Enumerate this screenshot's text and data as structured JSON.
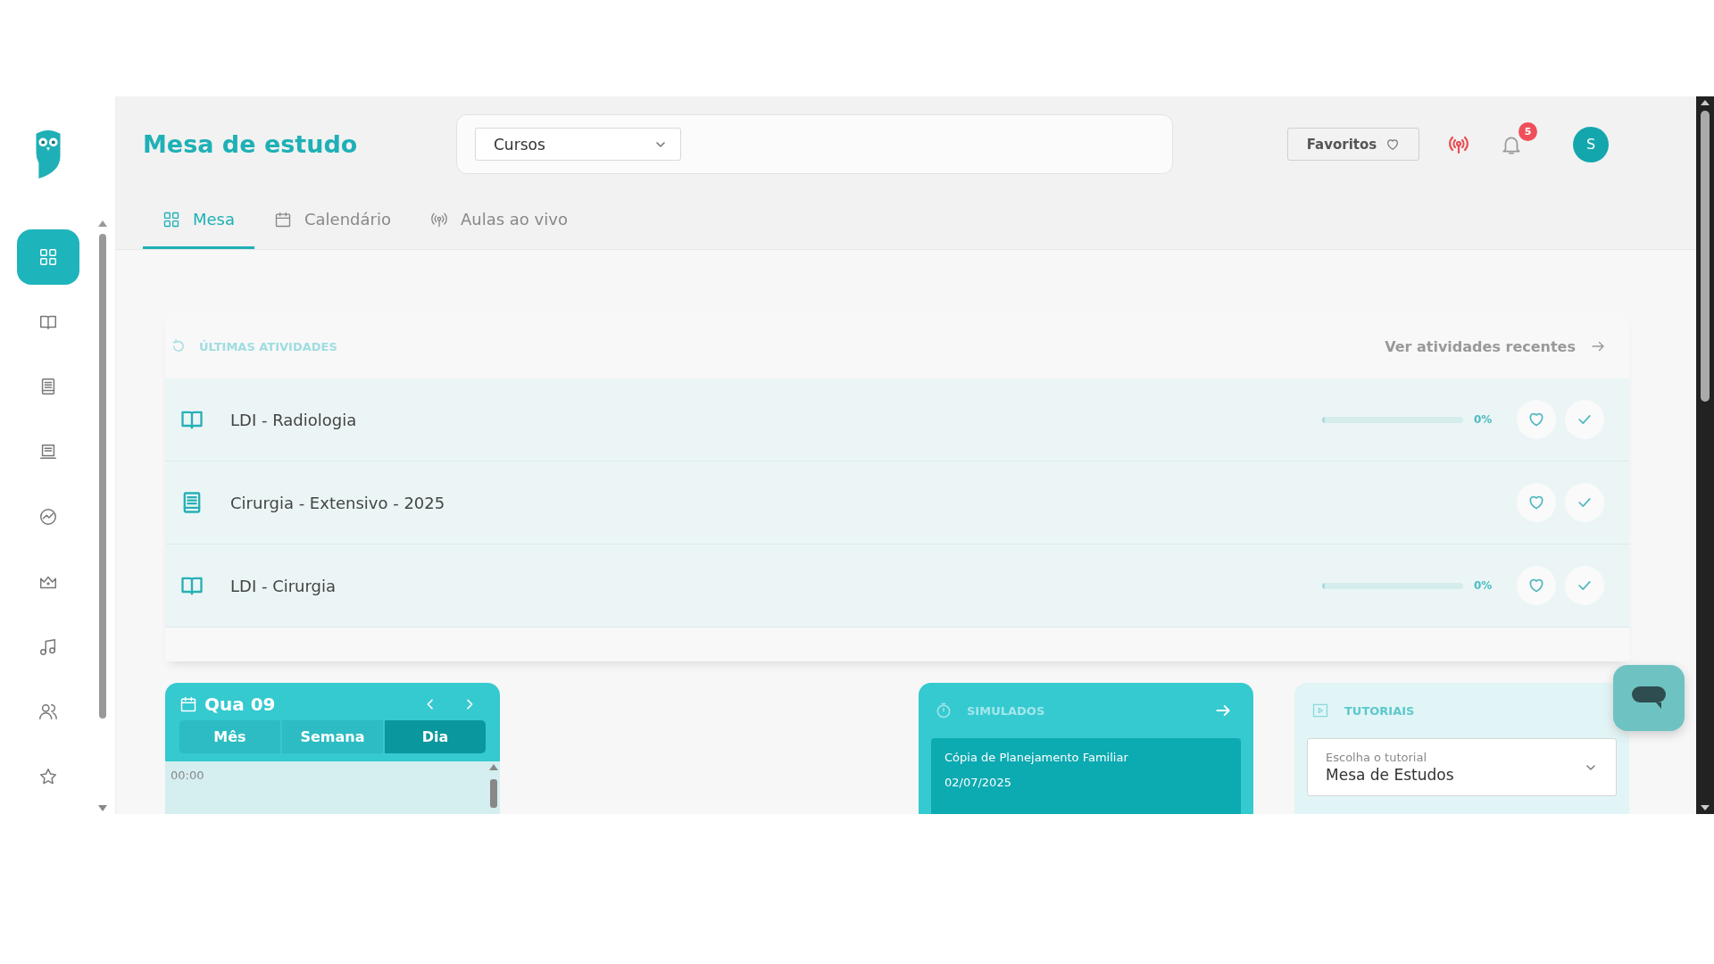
{
  "sidebar": {
    "items": [
      {
        "kind": "grid",
        "selected": true
      },
      {
        "kind": "book",
        "selected": false
      },
      {
        "kind": "notebook",
        "selected": false
      },
      {
        "kind": "laptop",
        "selected": false
      },
      {
        "kind": "chart",
        "selected": false
      },
      {
        "kind": "crown",
        "selected": false
      },
      {
        "kind": "music",
        "selected": false
      },
      {
        "kind": "people",
        "selected": false
      },
      {
        "kind": "star",
        "selected": false
      }
    ]
  },
  "header": {
    "title": "Mesa de estudo",
    "course_select": {
      "value": "Cursos"
    },
    "favorites_button": "Favoritos",
    "notifications": {
      "count": "5"
    },
    "avatar": "S"
  },
  "tabs": [
    {
      "label": "Mesa",
      "kind": "grid",
      "selected": true
    },
    {
      "label": "Calendário",
      "kind": "calendar",
      "selected": false
    },
    {
      "label": "Aulas ao vivo",
      "kind": "live",
      "selected": false
    }
  ],
  "recent": {
    "title": "ÚLTIMAS ATIVIDADES",
    "link": "Ver atividades recentes",
    "rows": [
      {
        "kind": "book",
        "title": "LDI - Radiologia",
        "progress": {
          "level": 0,
          "reading": "0%"
        }
      },
      {
        "kind": "notebook",
        "title": "Cirurgia - Extensivo - 2025"
      },
      {
        "kind": "book",
        "title": "LDI - Cirurgia",
        "progress": {
          "level": 0,
          "reading": "0%"
        }
      }
    ]
  },
  "calendar": {
    "date": "Qua 09",
    "views": [
      {
        "label": "Mês",
        "selected": false
      },
      {
        "label": "Semana",
        "selected": false
      },
      {
        "label": "Dia",
        "selected": true
      }
    ],
    "times": [
      "00:00"
    ]
  },
  "simulados": {
    "title": "SIMULADOS",
    "items": [
      {
        "name": "Cópia de Planejamento Familiar",
        "date": "02/07/2025"
      }
    ]
  },
  "tutorials": {
    "title": "TUTORIAIS",
    "select": {
      "label": "Escolha o tutorial",
      "value": "Mesa de Estudos"
    }
  }
}
